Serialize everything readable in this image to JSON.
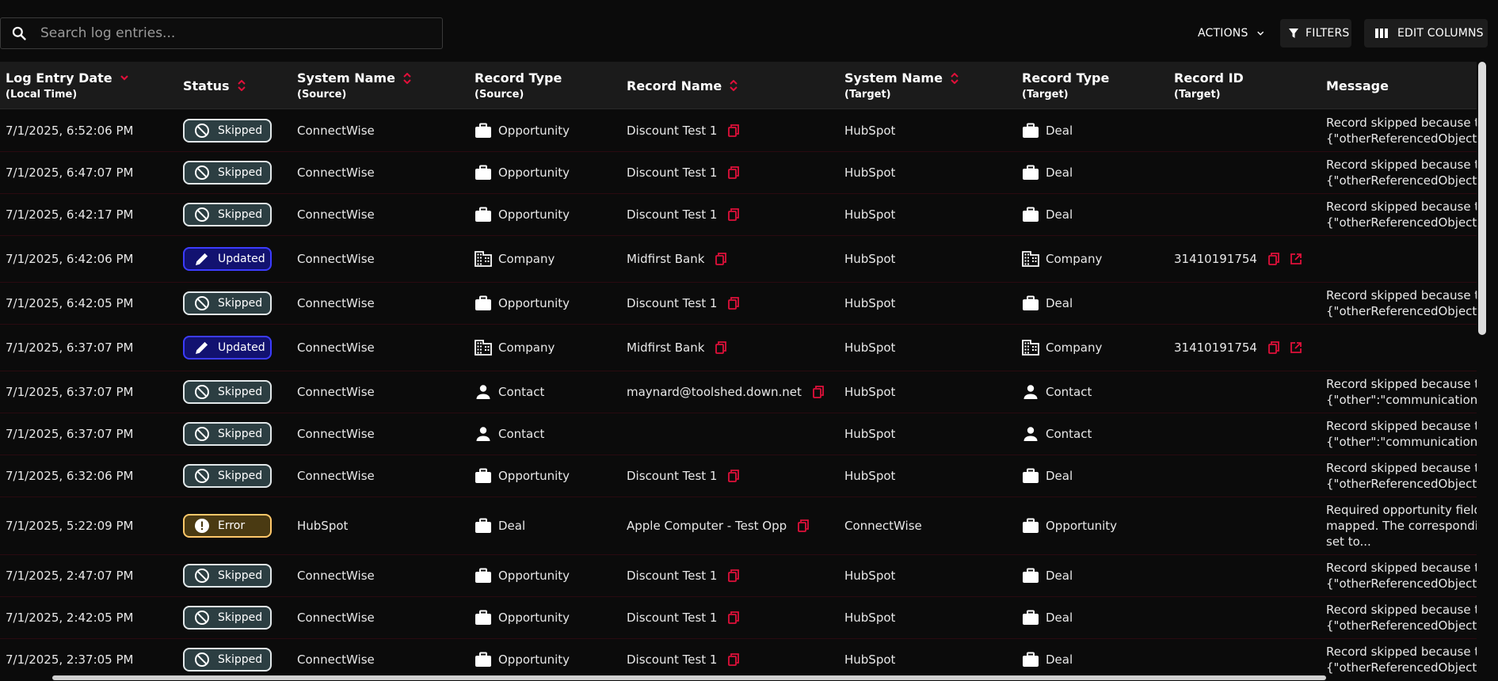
{
  "toolbar": {
    "search_placeholder": "Search log entries...",
    "actions_label": "ACTIONS",
    "filters_label": "FILTERS",
    "edit_columns_label": "EDIT COLUMNS"
  },
  "columns": [
    {
      "label": "Log Entry Date",
      "sub": "(Local Time)",
      "sort": "desc"
    },
    {
      "label": "Status",
      "sub": "",
      "sort": "both"
    },
    {
      "label": "System Name",
      "sub": "(Source)",
      "sort": "both"
    },
    {
      "label": "Record Type",
      "sub": "(Source)",
      "sort": ""
    },
    {
      "label": "Record Name",
      "sub": "",
      "sort": "both"
    },
    {
      "label": "System Name",
      "sub": "(Target)",
      "sort": "both"
    },
    {
      "label": "Record Type",
      "sub": "(Target)",
      "sort": ""
    },
    {
      "label": "Record ID",
      "sub": "(Target)",
      "sort": ""
    },
    {
      "label": "Message",
      "sub": "",
      "sort": ""
    }
  ],
  "rows": [
    {
      "date": "7/1/2025, 6:52:06 PM",
      "status": "Skipped",
      "src_system": "ConnectWise",
      "src_type": "Opportunity",
      "src_icon": "briefcase-icon",
      "record_name": "Discount Test 1",
      "tgt_system": "HubSpot",
      "tgt_type": "Deal",
      "tgt_icon": "briefcase-icon",
      "record_id": "",
      "message": "Record skipped because th\n{\"otherReferencedObjectTy"
    },
    {
      "date": "7/1/2025, 6:47:07 PM",
      "status": "Skipped",
      "src_system": "ConnectWise",
      "src_type": "Opportunity",
      "src_icon": "briefcase-icon",
      "record_name": "Discount Test 1",
      "tgt_system": "HubSpot",
      "tgt_type": "Deal",
      "tgt_icon": "briefcase-icon",
      "record_id": "",
      "message": "Record skipped because th\n{\"otherReferencedObjectTy"
    },
    {
      "date": "7/1/2025, 6:42:17 PM",
      "status": "Skipped",
      "src_system": "ConnectWise",
      "src_type": "Opportunity",
      "src_icon": "briefcase-icon",
      "record_name": "Discount Test 1",
      "tgt_system": "HubSpot",
      "tgt_type": "Deal",
      "tgt_icon": "briefcase-icon",
      "record_id": "",
      "message": "Record skipped because th\n{\"otherReferencedObjectTy"
    },
    {
      "date": "7/1/2025, 6:42:06 PM",
      "status": "Updated",
      "src_system": "ConnectWise",
      "src_type": "Company",
      "src_icon": "building-icon",
      "record_name": "Midfirst Bank",
      "tgt_system": "HubSpot",
      "tgt_type": "Company",
      "tgt_icon": "building-icon",
      "record_id": "31410191754",
      "message": ""
    },
    {
      "date": "7/1/2025, 6:42:05 PM",
      "status": "Skipped",
      "src_system": "ConnectWise",
      "src_type": "Opportunity",
      "src_icon": "briefcase-icon",
      "record_name": "Discount Test 1",
      "tgt_system": "HubSpot",
      "tgt_type": "Deal",
      "tgt_icon": "briefcase-icon",
      "record_id": "",
      "message": "Record skipped because th\n{\"otherReferencedObjectTy"
    },
    {
      "date": "7/1/2025, 6:37:07 PM",
      "status": "Updated",
      "src_system": "ConnectWise",
      "src_type": "Company",
      "src_icon": "building-icon",
      "record_name": "Midfirst Bank",
      "tgt_system": "HubSpot",
      "tgt_type": "Company",
      "tgt_icon": "building-icon",
      "record_id": "31410191754",
      "message": ""
    },
    {
      "date": "7/1/2025, 6:37:07 PM",
      "status": "Skipped",
      "src_system": "ConnectWise",
      "src_type": "Contact",
      "src_icon": "person-icon",
      "record_name": "maynard@toolshed.down.net",
      "tgt_system": "HubSpot",
      "tgt_type": "Contact",
      "tgt_icon": "person-icon",
      "record_id": "",
      "message": "Record skipped because th\n{\"other\":\"communicationIte"
    },
    {
      "date": "7/1/2025, 6:37:07 PM",
      "status": "Skipped",
      "src_system": "ConnectWise",
      "src_type": "Contact",
      "src_icon": "person-icon",
      "record_name": "",
      "tgt_system": "HubSpot",
      "tgt_type": "Contact",
      "tgt_icon": "person-icon",
      "record_id": "",
      "message": "Record skipped because th\n{\"other\":\"communicationIte"
    },
    {
      "date": "7/1/2025, 6:32:06 PM",
      "status": "Skipped",
      "src_system": "ConnectWise",
      "src_type": "Opportunity",
      "src_icon": "briefcase-icon",
      "record_name": "Discount Test 1",
      "tgt_system": "HubSpot",
      "tgt_type": "Deal",
      "tgt_icon": "briefcase-icon",
      "record_id": "",
      "message": "Record skipped because th\n{\"otherReferencedObjectTy"
    },
    {
      "date": "7/1/2025, 5:22:09 PM",
      "status": "Error",
      "src_system": "HubSpot",
      "src_type": "Deal",
      "src_icon": "briefcase-icon",
      "record_name": "Apple Computer - Test Opp",
      "tgt_system": "ConnectWise",
      "tgt_type": "Opportunity",
      "tgt_icon": "briefcase-icon",
      "record_id": "",
      "message": "Required opportunity field\nmapped. The correspondin\nset to..."
    },
    {
      "date": "7/1/2025, 2:47:07 PM",
      "status": "Skipped",
      "src_system": "ConnectWise",
      "src_type": "Opportunity",
      "src_icon": "briefcase-icon",
      "record_name": "Discount Test 1",
      "tgt_system": "HubSpot",
      "tgt_type": "Deal",
      "tgt_icon": "briefcase-icon",
      "record_id": "",
      "message": "Record skipped because th\n{\"otherReferencedObjectTy"
    },
    {
      "date": "7/1/2025, 2:42:05 PM",
      "status": "Skipped",
      "src_system": "ConnectWise",
      "src_type": "Opportunity",
      "src_icon": "briefcase-icon",
      "record_name": "Discount Test 1",
      "tgt_system": "HubSpot",
      "tgt_type": "Deal",
      "tgt_icon": "briefcase-icon",
      "record_id": "",
      "message": "Record skipped because th\n{\"otherReferencedObjectTy"
    },
    {
      "date": "7/1/2025, 2:37:05 PM",
      "status": "Skipped",
      "src_system": "ConnectWise",
      "src_type": "Opportunity",
      "src_icon": "briefcase-icon",
      "record_name": "Discount Test 1",
      "tgt_system": "HubSpot",
      "tgt_type": "Deal",
      "tgt_icon": "briefcase-icon",
      "record_id": "",
      "message": "Record skipped because th\n{\"otherReferencedObjectTy"
    }
  ],
  "colors": {
    "accent": "#e0103a",
    "background": "#0b0b0b",
    "header": "#1b1b1b",
    "skipped_badge": "#2c3e42",
    "updated_badge": "#121270",
    "error_badge": "#4a3a12"
  }
}
